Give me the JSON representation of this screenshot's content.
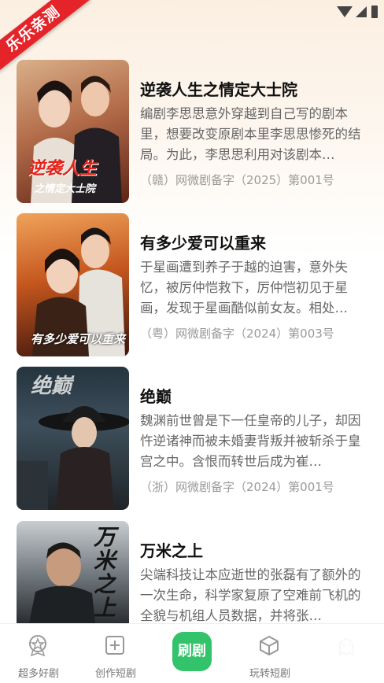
{
  "ribbon": "乐乐亲测",
  "dramas": [
    {
      "title": "逆袭人生之情定大士院",
      "desc": "编剧李思思意外穿越到自己写的剧本里，想要改变原剧本里李思思惨死的结局。为此，李思思利用对该剧本…",
      "reg": "（赣）网微剧备字（2025）第001号",
      "poster_text": "逆袭人生",
      "poster_sub": "之情定大士院"
    },
    {
      "title": "有多少爱可以重来",
      "desc": "于星画遭到养子于越的迫害，意外失忆，被厉仲恺救下，厉仲恺初见于星画，发现于星画酷似前女友。相处…",
      "reg": "（粤）网微剧备字（2024）第003号",
      "poster_text": "有多少爱可以重来",
      "poster_sub": ""
    },
    {
      "title": "绝巅",
      "desc": "魏渊前世曾是下一任皇帝的儿子，却因忤逆诸神而被未婚妻背叛并被斩杀于皇宫之中。含恨而转世后成为崔…",
      "reg": "（浙）网微剧备字（2024）第001号",
      "poster_text": "绝巅",
      "poster_sub": ""
    },
    {
      "title": "万米之上",
      "desc": "尖端科技让本应逝世的张磊有了额外的一次生命，科学家复原了空难前飞机的全貌与机组人员数据，并将张…",
      "reg": "",
      "poster_text": "万米之上",
      "poster_sub": ""
    }
  ],
  "tabs": [
    {
      "label": "超多好剧",
      "icon": "star-badge-icon"
    },
    {
      "label": "创作短剧",
      "icon": "add-square-icon"
    },
    {
      "label": "刷剧",
      "icon": "play-center-button"
    },
    {
      "label": "玩转短剧",
      "icon": "cube-icon"
    },
    {
      "label": "",
      "icon": "profile-icon"
    }
  ]
}
